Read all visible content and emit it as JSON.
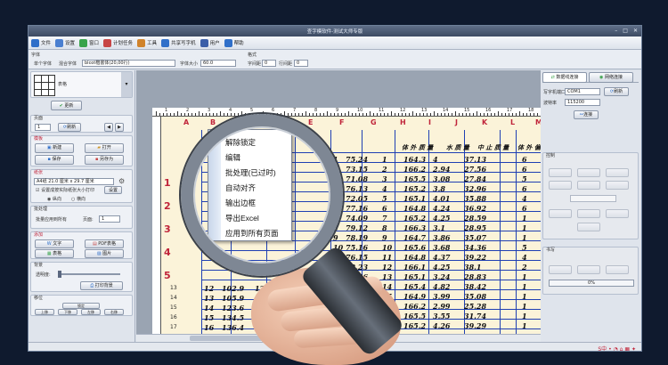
{
  "window": {
    "title": "查字模软件-测试大师专版"
  },
  "menu": [
    {
      "label": "文件",
      "icon": "file-icon",
      "color": "#2f6fc9"
    },
    {
      "label": "设置",
      "icon": "gear-icon",
      "color": "#4a7fd0"
    },
    {
      "label": "窗口",
      "icon": "window-icon",
      "color": "#38a34a"
    },
    {
      "label": "计划任务",
      "icon": "calendar-icon",
      "color": "#c74545"
    },
    {
      "label": "工具",
      "icon": "tool-icon",
      "color": "#d0832b"
    },
    {
      "label": "共享写字机",
      "icon": "share-icon",
      "color": "#2f6fc9"
    },
    {
      "label": "用户",
      "icon": "user-icon",
      "color": "#3a5ea8"
    },
    {
      "label": "帮助",
      "icon": "help-icon",
      "color": "#2f6fc9"
    }
  ],
  "toolbar": {
    "font_label": "字体",
    "style_label": "格式",
    "font_single": "单个字体",
    "font_mixed": "混合字体",
    "font_value": "blcot楷書体(20,00行)",
    "size_label": "字体大小",
    "size_value": "60.0",
    "spacing_label": "字间距",
    "spacing_value": "0",
    "line_label": "行间距",
    "line_value": "0"
  },
  "left_panel": {
    "template_label": "表格",
    "ok_label": "更新",
    "page_group": "页面",
    "page_value": "1",
    "refresh_label": "刷新",
    "file_group": "模板",
    "new_label": "新建",
    "open_label": "打开",
    "save_label": "保存",
    "saveas_label": "另存为",
    "paper_group": "纸张",
    "paper_value": "A4纸 21.0 厘米 x 29.7 厘米",
    "auto_label": "设置成按实际纸张大小打印",
    "settings_label": "设置",
    "portrait_label": "纵向",
    "landscape_label": "横向",
    "batch_group": "批处理",
    "batch_label": "批量应用到所有",
    "batch_pages": "页面:",
    "batch_value": "1",
    "add_group": "添加",
    "add_text": "文字",
    "add_pdf": "PDF表格",
    "add_table": "表格",
    "add_image": "图片",
    "bg_group": "背景",
    "opacity_label": "透明度:",
    "print_bg_label": "打印背景",
    "nav_group": "移位",
    "nav_center": "锁定",
    "nav_up": "上移",
    "nav_down": "下移",
    "nav_left": "左移",
    "nav_right": "右移"
  },
  "right_panel": {
    "tab_serial": "数据线连接",
    "tab_wifi": "网络连接",
    "port_label": "写字机端口",
    "port_value": "COM1",
    "port_refresh": "刷新",
    "baud_label": "波特率",
    "baud_value": "115200",
    "connect_label": "连接",
    "control_group": "控制",
    "write_group": "书写",
    "progress_value": "0%"
  },
  "sheet": {
    "columns": [
      "A",
      "B",
      "C",
      "D",
      "E",
      "F",
      "G",
      "H",
      "I",
      "J",
      "K",
      "L",
      "M"
    ],
    "headers": [
      "体重（kg）",
      "水质量",
      "中止质量",
      "体外偏"
    ],
    "header_texts": [
      "体 外 质 量",
      "水 质 量",
      "中 止 质 量",
      "体 外 偏"
    ],
    "row_numbers": [
      "1",
      "2",
      "3",
      "4",
      "5"
    ],
    "left_row_numbers": [
      "13",
      "14",
      "15",
      "16",
      "17",
      "18",
      "19"
    ],
    "rows": [
      [
        "1",
        "75.24",
        "1",
        "164.3",
        "4",
        "37.13",
        "6"
      ],
      [
        "2",
        "73.15",
        "2",
        "166.2",
        "2.94",
        "27.56",
        "6"
      ],
      [
        "3",
        "71.08",
        "3",
        "165.5",
        "3.08",
        "27.84",
        "5"
      ],
      [
        "4",
        "76.13",
        "4",
        "165.2",
        "3.8",
        "32.96",
        "6"
      ],
      [
        "5",
        "72.05",
        "5",
        "165.1",
        "4.01",
        "35.88",
        "4"
      ],
      [
        "6",
        "77.16",
        "6",
        "164.8",
        "4.24",
        "36.92",
        "6"
      ],
      [
        "7",
        "74.09",
        "7",
        "165.2",
        "4.25",
        "28.59",
        "1"
      ],
      [
        "8",
        "79.12",
        "8",
        "166.3",
        "3.1",
        "28.95",
        "1"
      ],
      [
        "9",
        "78.19",
        "9",
        "164.7",
        "3.86",
        "35.07",
        "1"
      ],
      [
        "10",
        "75.16",
        "10",
        "165.6",
        "3.68",
        "34.36",
        "5"
      ],
      [
        "11",
        "76.15",
        "11",
        "164.8",
        "4.37",
        "39.22",
        "4"
      ],
      [
        "12",
        "72.23",
        "12",
        "166.1",
        "4.25",
        "38.1",
        "2"
      ],
      [
        "13",
        "74.36",
        "13",
        "165.1",
        "3.24",
        "28.83",
        "1"
      ],
      [
        "14",
        "73.02",
        "14",
        "165.4",
        "4.82",
        "38.42",
        "1"
      ],
      [
        "15",
        "71.24",
        "15",
        "164.9",
        "3.99",
        "35.08",
        "1"
      ],
      [
        "16",
        "74.56",
        "16",
        "166.2",
        "2.99",
        "25.28",
        "1"
      ],
      [
        "17",
        "71.23",
        "17",
        "165.5",
        "3.55",
        "31.74",
        "1"
      ],
      [
        "18",
        "73.79",
        "18",
        "165.2",
        "4.26",
        "39.29",
        "1"
      ]
    ],
    "left_rows": [
      [
        "12",
        "102.9",
        "12"
      ],
      [
        "13",
        "105.9",
        "13"
      ],
      [
        "14",
        "123.6",
        "14"
      ],
      [
        "15",
        "134.5",
        "15"
      ],
      [
        "16",
        "136.4",
        "16"
      ],
      [
        "17",
        "107.3",
        "17"
      ],
      [
        "18",
        "102.7",
        "18"
      ]
    ],
    "row_twelve_mid": "80"
  },
  "context_menu": {
    "items": [
      "解除锁定",
      "编辑",
      "批处理(已过时)",
      "自动对齐",
      "输出边框",
      "导出Excel",
      "应用到所有页面"
    ]
  },
  "ruler_marks": [
    "1",
    "2",
    "3",
    "4",
    "5",
    "6",
    "7",
    "8",
    "9",
    "10",
    "11",
    "12",
    "13",
    "14",
    "15",
    "16",
    "17",
    "18"
  ]
}
